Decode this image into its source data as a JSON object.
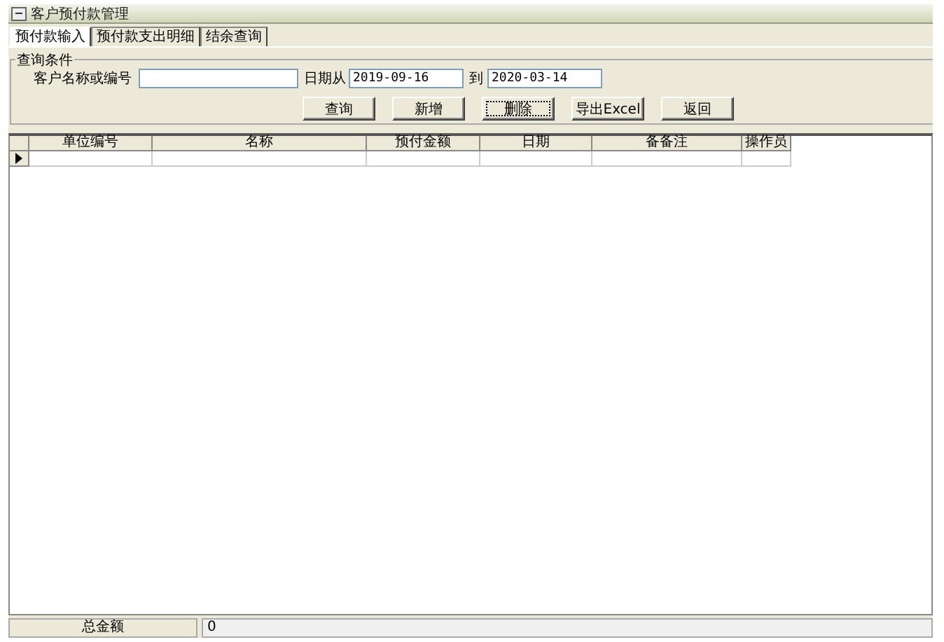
{
  "window": {
    "title": "客户预付款管理"
  },
  "tabs": [
    {
      "label": "预付款输入",
      "selected": true
    },
    {
      "label": "预付款支出明细",
      "selected": false
    },
    {
      "label": "结余查询",
      "selected": false
    }
  ],
  "query": {
    "legend": "查询条件",
    "customer_label": "客户名称或编号",
    "date_from_label": "日期从",
    "date_from": "2019-09-16",
    "date_to_label": "到",
    "date_to": "2020-03-14"
  },
  "buttons": [
    {
      "label": "查询",
      "focused": false
    },
    {
      "label": "新增",
      "focused": false
    },
    {
      "label": "删除",
      "focused": true
    },
    {
      "label": "导出Excel",
      "focused": false
    },
    {
      "label": "返回",
      "focused": false
    }
  ],
  "table": {
    "columns": [
      "单位编号",
      "名称",
      "预付金额",
      "日期",
      "备备注",
      "操作员"
    ],
    "rows": [
      {
        "current": true
      }
    ]
  },
  "footer": {
    "label": "总金额",
    "value": "0"
  }
}
